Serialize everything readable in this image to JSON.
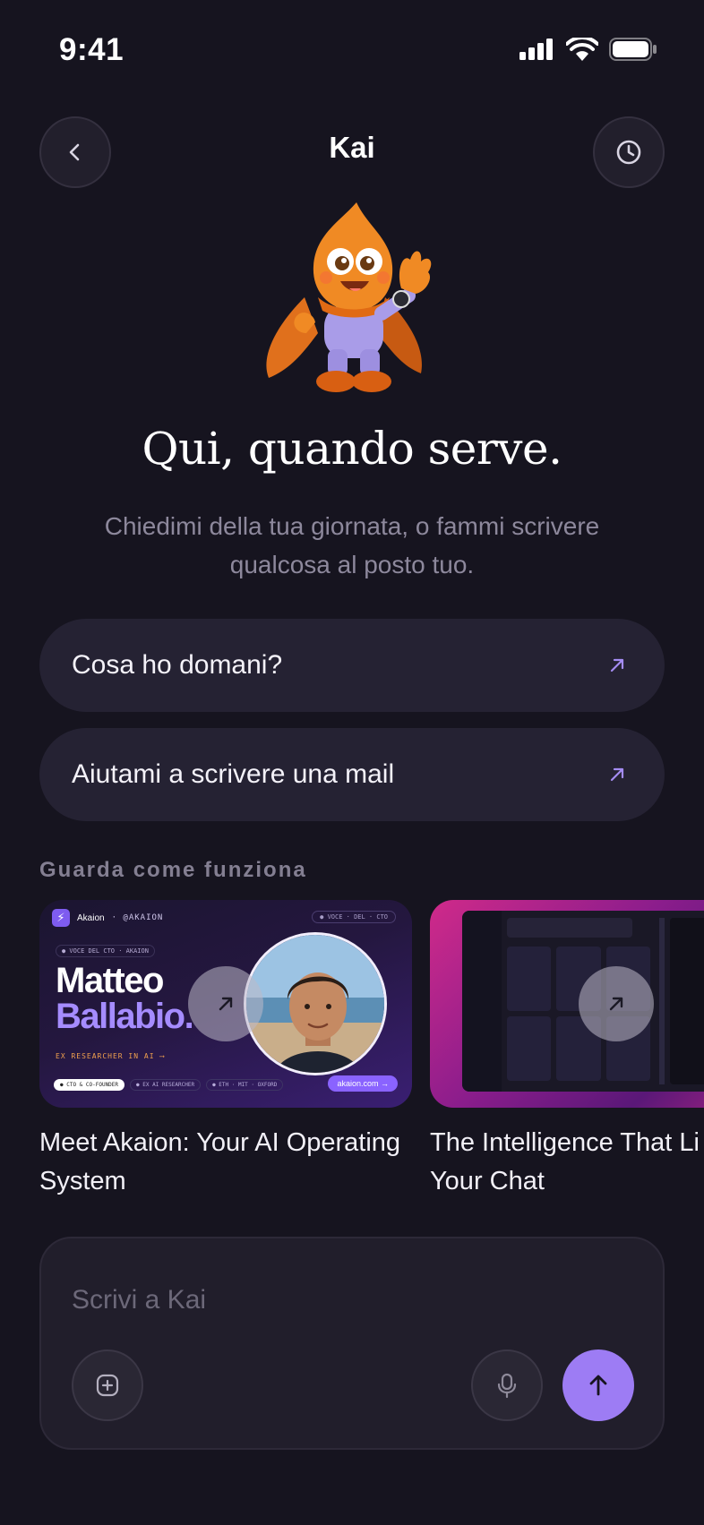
{
  "status_bar": {
    "time": "9:41"
  },
  "header": {
    "title": "Kai"
  },
  "hero": {
    "title": "Qui, quando serve.",
    "subtitle": "Chiedimi della tua giornata, o fammi scrivere qualcosa al posto tuo."
  },
  "suggestions": [
    {
      "label": "Cosa ho domani?"
    },
    {
      "label": "Aiutami a scrivere una mail"
    }
  ],
  "videos_section": {
    "label": "Guarda come funziona",
    "items": [
      {
        "title_line1": "Meet Akaion: Your AI Operating",
        "title_line2": "System",
        "thumb": {
          "brand": "Akaion",
          "brand_tag": "· @AKAION",
          "pill": "● VOCE · DEL · CTO",
          "tag": "● VOCE DEL CTO · AKAION",
          "name_line1": "Matteo",
          "name_line2": "Ballabio.",
          "role": "EX RESEARCHER IN AI",
          "chips": [
            "● CTO & CO-FOUNDER",
            "● EX AI RESEARCHER",
            "● ETH · MIT · OXFORD"
          ],
          "site": "akaion.com →"
        }
      },
      {
        "title_line1": "The Intelligence That Li",
        "title_line2": "Your Chat"
      }
    ]
  },
  "composer": {
    "placeholder": "Scrivi a Kai"
  },
  "colors": {
    "accent": "#9d7cf4",
    "background": "#16141f",
    "surface": "#252233"
  }
}
